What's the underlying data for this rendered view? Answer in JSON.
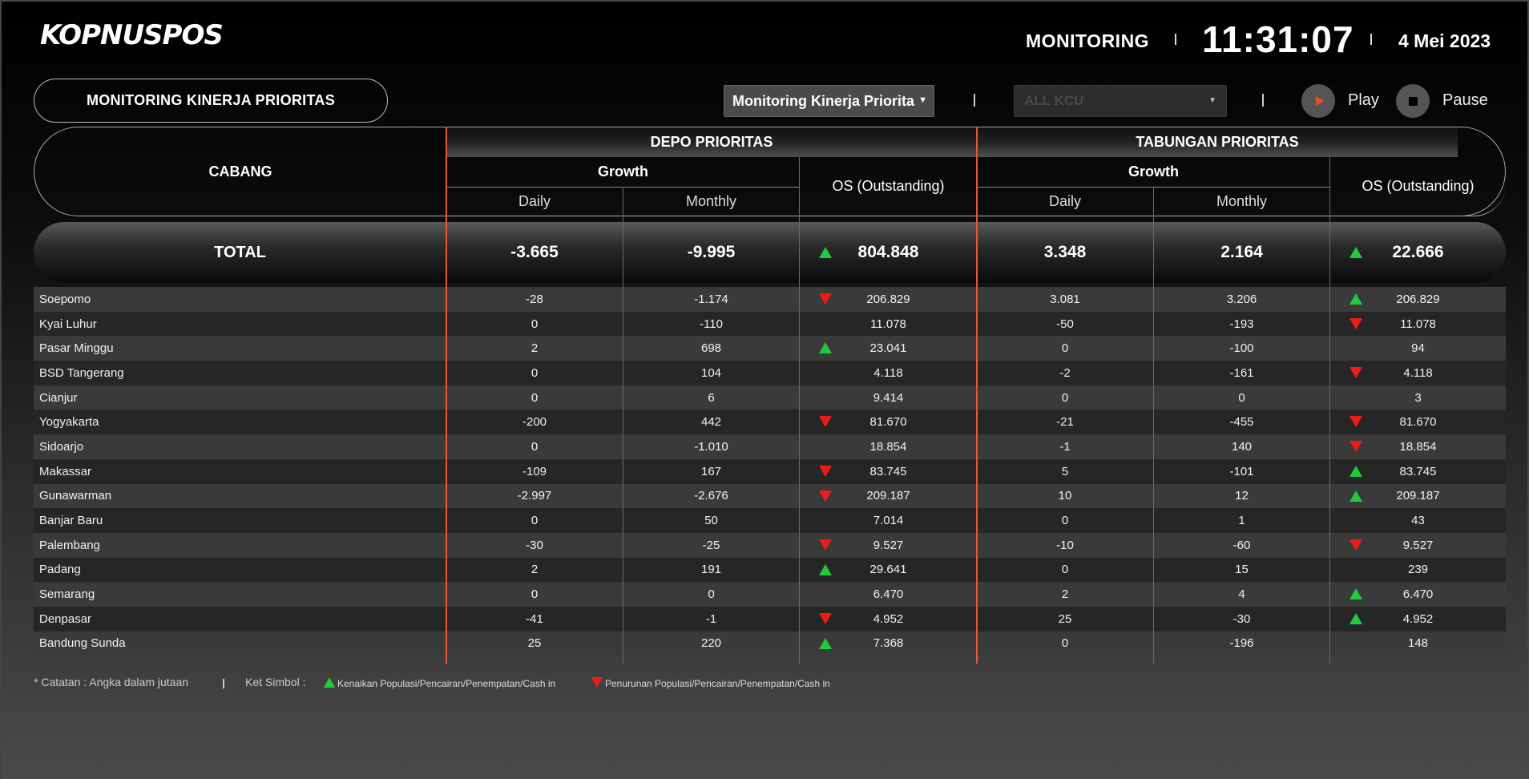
{
  "header": {
    "logo": "KOPNUSPOS",
    "section": "MONITORING",
    "time": "11:31:07",
    "date": "4 Mei 2023"
  },
  "controls": {
    "page_title": "MONITORING KINERJA PRIORITAS",
    "view_select": "Monitoring Kinerja Priorita",
    "kcu_select": "ALL KCU",
    "play_label": "Play",
    "pause_label": "Pause"
  },
  "table": {
    "cabang_header": "CABANG",
    "depo_header": "DEPO PRIORITAS",
    "tabungan_header": "TABUNGAN PRIORITAS",
    "growth_header": "Growth",
    "daily_header": "Daily",
    "monthly_header": "Monthly",
    "os_header": "OS (Outstanding)",
    "total": {
      "label": "TOTAL",
      "depo_daily": "-3.665",
      "depo_monthly": "-9.995",
      "depo_os": "804.848",
      "depo_os_trend": "up",
      "tab_daily": "3.348",
      "tab_monthly": "2.164",
      "tab_os": "22.666",
      "tab_os_trend": "up"
    },
    "rows": [
      {
        "name": "Soepomo",
        "depo_daily": "-28",
        "depo_monthly": "-1.174",
        "depo_os": "206.829",
        "depo_trend": "down",
        "tab_daily": "3.081",
        "tab_monthly": "3.206",
        "tab_os": "206.829",
        "tab_trend": "up"
      },
      {
        "name": "Kyai Luhur",
        "depo_daily": "0",
        "depo_monthly": "-110",
        "depo_os": "11.078",
        "depo_trend": "",
        "tab_daily": "-50",
        "tab_monthly": "-193",
        "tab_os": "11.078",
        "tab_trend": "down"
      },
      {
        "name": "Pasar Minggu",
        "depo_daily": "2",
        "depo_monthly": "698",
        "depo_os": "23.041",
        "depo_trend": "up",
        "tab_daily": "0",
        "tab_monthly": "-100",
        "tab_os": "94",
        "tab_trend": ""
      },
      {
        "name": "BSD Tangerang",
        "depo_daily": "0",
        "depo_monthly": "104",
        "depo_os": "4.118",
        "depo_trend": "",
        "tab_daily": "-2",
        "tab_monthly": "-161",
        "tab_os": "4.118",
        "tab_trend": "down"
      },
      {
        "name": "Cianjur",
        "depo_daily": "0",
        "depo_monthly": "6",
        "depo_os": "9.414",
        "depo_trend": "",
        "tab_daily": "0",
        "tab_monthly": "0",
        "tab_os": "3",
        "tab_trend": ""
      },
      {
        "name": "Yogyakarta",
        "depo_daily": "-200",
        "depo_monthly": "442",
        "depo_os": "81.670",
        "depo_trend": "down",
        "tab_daily": "-21",
        "tab_monthly": "-455",
        "tab_os": "81.670",
        "tab_trend": "down"
      },
      {
        "name": "Sidoarjo",
        "depo_daily": "0",
        "depo_monthly": "-1.010",
        "depo_os": "18.854",
        "depo_trend": "",
        "tab_daily": "-1",
        "tab_monthly": "140",
        "tab_os": "18.854",
        "tab_trend": "down"
      },
      {
        "name": "Makassar",
        "depo_daily": "-109",
        "depo_monthly": "167",
        "depo_os": "83.745",
        "depo_trend": "down",
        "tab_daily": "5",
        "tab_monthly": "-101",
        "tab_os": "83.745",
        "tab_trend": "up"
      },
      {
        "name": "Gunawarman",
        "depo_daily": "-2.997",
        "depo_monthly": "-2.676",
        "depo_os": "209.187",
        "depo_trend": "down",
        "tab_daily": "10",
        "tab_monthly": "12",
        "tab_os": "209.187",
        "tab_trend": "up"
      },
      {
        "name": "Banjar Baru",
        "depo_daily": "0",
        "depo_monthly": "50",
        "depo_os": "7.014",
        "depo_trend": "",
        "tab_daily": "0",
        "tab_monthly": "1",
        "tab_os": "43",
        "tab_trend": ""
      },
      {
        "name": "Palembang",
        "depo_daily": "-30",
        "depo_monthly": "-25",
        "depo_os": "9.527",
        "depo_trend": "down",
        "tab_daily": "-10",
        "tab_monthly": "-60",
        "tab_os": "9.527",
        "tab_trend": "down"
      },
      {
        "name": "Padang",
        "depo_daily": "2",
        "depo_monthly": "191",
        "depo_os": "29.641",
        "depo_trend": "up",
        "tab_daily": "0",
        "tab_monthly": "15",
        "tab_os": "239",
        "tab_trend": ""
      },
      {
        "name": "Semarang",
        "depo_daily": "0",
        "depo_monthly": "0",
        "depo_os": "6.470",
        "depo_trend": "",
        "tab_daily": "2",
        "tab_monthly": "4",
        "tab_os": "6.470",
        "tab_trend": "up"
      },
      {
        "name": "Denpasar",
        "depo_daily": "-41",
        "depo_monthly": "-1",
        "depo_os": "4.952",
        "depo_trend": "down",
        "tab_daily": "25",
        "tab_monthly": "-30",
        "tab_os": "4.952",
        "tab_trend": "up"
      },
      {
        "name": "Bandung Sunda",
        "depo_daily": "25",
        "depo_monthly": "220",
        "depo_os": "7.368",
        "depo_trend": "up",
        "tab_daily": "0",
        "tab_monthly": "-196",
        "tab_os": "148",
        "tab_trend": ""
      }
    ]
  },
  "footer": {
    "note": "* Catatan : Angka dalam jutaan",
    "ket": "Ket Simbol :",
    "legend_up": "Kenaikan Populasi/Pencairan/Penempatan/Cash in",
    "legend_down": "Penurunan Populasi/Pencairan/Penempatan/Cash in"
  },
  "colors": {
    "accent_red_line": "#e45a35",
    "up_green": "#1fcb3c",
    "down_red": "#ee1b1b",
    "play_orange": "#e0522a"
  },
  "icons": [
    "play-icon",
    "stop-icon",
    "caret-down-icon",
    "trend-up-icon",
    "trend-down-icon"
  ]
}
